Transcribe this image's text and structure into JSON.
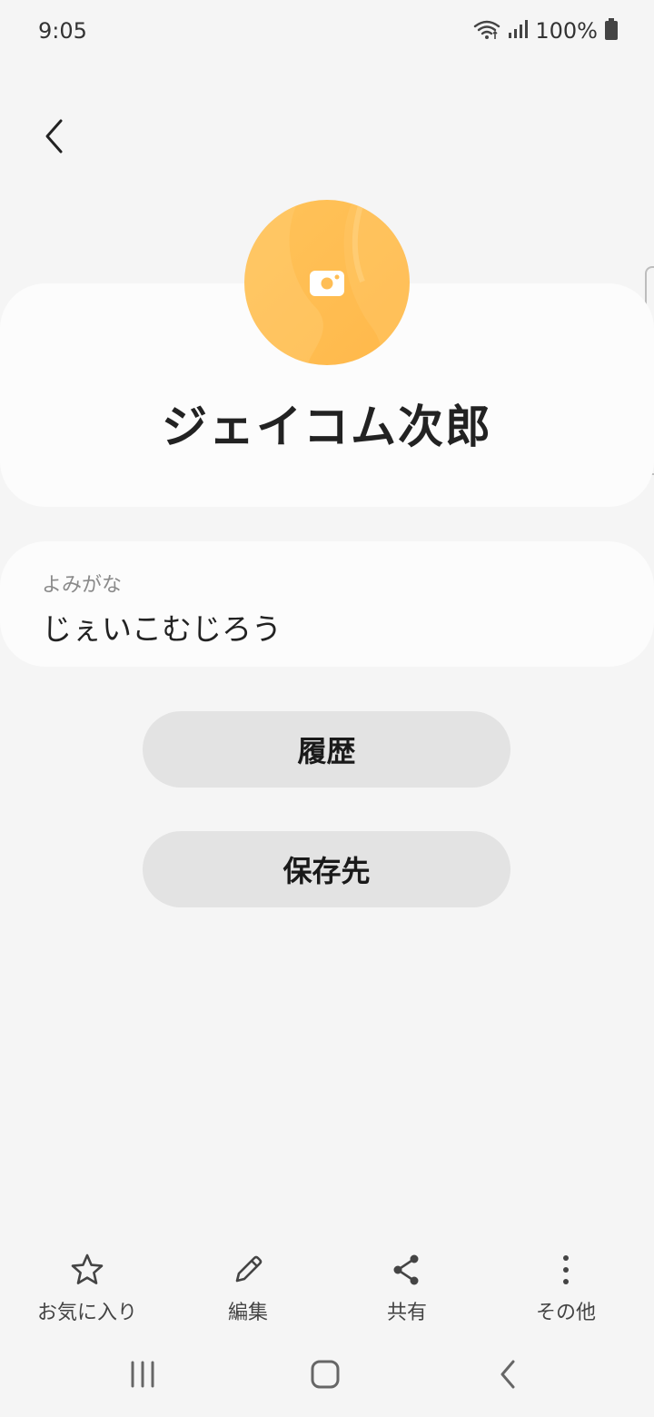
{
  "status_bar": {
    "time": "9:05",
    "battery": "100%",
    "icons": [
      "wifi-icon",
      "signal-icon",
      "battery-icon"
    ]
  },
  "header": {
    "back_icon": "chevron-left-icon"
  },
  "contact": {
    "avatar_icon": "camera-icon",
    "avatar_color": "#FFBE55",
    "name": "ジェイコム次郎"
  },
  "reading": {
    "label": "よみがな",
    "value": "じぇいこむじろう"
  },
  "buttons": {
    "history_label": "履歴",
    "storage_label": "保存先"
  },
  "action_bar": {
    "items": [
      {
        "label": "お気に入り",
        "icon": "star-icon"
      },
      {
        "label": "編集",
        "icon": "pencil-icon"
      },
      {
        "label": "共有",
        "icon": "share-icon"
      },
      {
        "label": "その他",
        "icon": "more-vertical-icon"
      }
    ]
  },
  "nav_bar": {
    "icons": [
      "recents-icon",
      "home-icon",
      "back-icon"
    ]
  }
}
